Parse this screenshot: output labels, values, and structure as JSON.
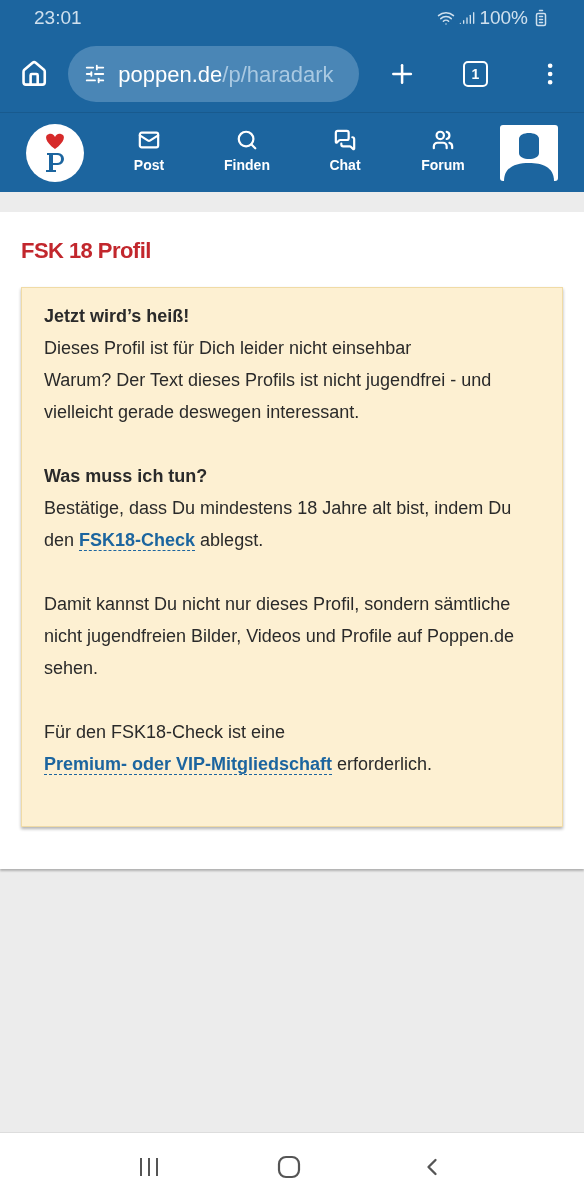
{
  "status_bar": {
    "time": "23:01",
    "battery": "100%"
  },
  "browser": {
    "url_host": "poppen.de",
    "url_path": "/p/haradark",
    "tab_count": "1"
  },
  "nav": {
    "items": [
      {
        "kind": "mail",
        "label": "Post"
      },
      {
        "kind": "search",
        "label": "Finden"
      },
      {
        "kind": "chat",
        "label": "Chat"
      },
      {
        "kind": "group",
        "label": "Forum"
      }
    ]
  },
  "page": {
    "title": "FSK 18 Profil",
    "notice": [
      {
        "kind": "heading",
        "parts": [
          {
            "kind": "text",
            "text": "Jetzt wird’s heiß!"
          }
        ]
      },
      {
        "kind": "line",
        "parts": [
          {
            "kind": "text",
            "text": "Dieses Profil ist für Dich leider nicht einsehbar"
          }
        ]
      },
      {
        "kind": "line",
        "parts": [
          {
            "kind": "text",
            "text": "Warum? Der Text dieses Profils ist nicht jugendfrei - und vielleicht gerade deswegen interessant."
          }
        ]
      },
      {
        "kind": "spacer_heading",
        "parts": [
          {
            "kind": "text",
            "text": "Was muss ich tun?"
          }
        ]
      },
      {
        "kind": "line",
        "parts": [
          {
            "kind": "text",
            "text": "Bestätige, dass Du mindestens 18 Jahre alt bist, indem Du den "
          },
          {
            "kind": "link",
            "text": "FSK18-Check"
          },
          {
            "kind": "text",
            "text": " ablegst."
          }
        ]
      },
      {
        "kind": "paragraph",
        "parts": [
          {
            "kind": "text",
            "text": "Damit kannst Du nicht nur dieses Profil, sondern sämtliche nicht jugendfreien Bilder, Videos und Profile auf Poppen.de sehen."
          }
        ]
      },
      {
        "kind": "paragraph",
        "parts": [
          {
            "kind": "text",
            "text": "Für den FSK18-Check ist eine "
          },
          {
            "kind": "link",
            "text": "Premium- oder VIP-Mitgliedschaft"
          },
          {
            "kind": "text",
            "text": " erforderlich."
          }
        ]
      }
    ]
  }
}
